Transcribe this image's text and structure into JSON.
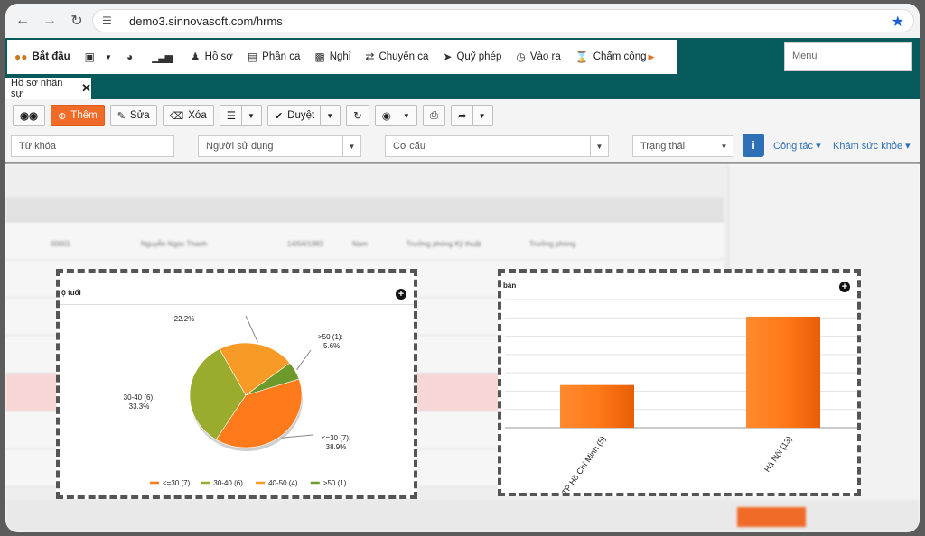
{
  "browser": {
    "url": "demo3.sinnovasoft.com/hrms"
  },
  "menu": {
    "items": [
      {
        "label": "Bắt đầu",
        "icon": "users-icon"
      },
      {
        "label": "",
        "icon": "cube-icon"
      },
      {
        "label": "",
        "icon": "dashboard-icon"
      },
      {
        "label": "",
        "icon": "bar-chart-icon"
      },
      {
        "label": "Hồ sơ",
        "icon": "user-icon"
      },
      {
        "label": "Phân ca",
        "icon": "list-icon"
      },
      {
        "label": "Nghỉ",
        "icon": "id-card-icon"
      },
      {
        "label": "Chuyển ca",
        "icon": "exchange-icon"
      },
      {
        "label": "Quỹ phép",
        "icon": "rocket-icon"
      },
      {
        "label": "Vào ra",
        "icon": "clock-icon"
      },
      {
        "label": "Chấm công",
        "icon": "hourglass-icon"
      }
    ],
    "search_placeholder": "Menu"
  },
  "tab": {
    "label": "Hồ sơ nhân sự"
  },
  "toolbar": {
    "add": "Thêm",
    "edit": "Sửa",
    "delete": "Xóa",
    "approve": "Duyệt"
  },
  "filters": {
    "keyword": "Từ khóa",
    "user": "Người sử dụng",
    "structure": "Cơ cấu",
    "status": "Trạng thái",
    "link_work": "Công tác",
    "link_health": "Khám sức khỏe"
  },
  "background": {
    "row1": [
      "00001",
      "Nguyễn Ngọc Thanh",
      "14/04/1983",
      "Nam",
      "Trưởng phòng Kỹ thuật",
      "Trưởng phòng"
    ]
  },
  "pie_panel": {
    "title": "ộ tuổi"
  },
  "bar_panel": {
    "title": "bàn"
  },
  "chart_data": [
    {
      "type": "pie",
      "title": "ộ tuổi",
      "slices": [
        {
          "label": "<=30 (7)",
          "value": 7,
          "percent": "38.9%",
          "color": "#ff7a1a"
        },
        {
          "label": "30-40 (6)",
          "value": 6,
          "percent": "33.3%",
          "color": "#9aab2e"
        },
        {
          "label": "40-50 (4)",
          "value": 4,
          "percent": "22.2%",
          "color": "#f79a26"
        },
        {
          "label": ">50 (1)",
          "value": 1,
          "percent": "5.6%",
          "color": "#6e9a2c"
        }
      ],
      "labels_shown": [
        "22.2%",
        ">50 (1):",
        "5.6%",
        "30-40 (6):",
        "33.3%",
        "<=30 (7):",
        "38.9%"
      ],
      "legend": [
        "<=30 (7)",
        "30-40 (6)",
        "40-50 (4)",
        ">50 (1)"
      ],
      "legend_position": "bottom"
    },
    {
      "type": "bar",
      "title": "bàn",
      "categories": [
        "TP Hồ Chí Minh (5)",
        "Hà Nội (13)"
      ],
      "values": [
        5,
        13
      ],
      "ylim": [
        0,
        15
      ],
      "color": "#ff7a1a",
      "grid": true
    }
  ]
}
